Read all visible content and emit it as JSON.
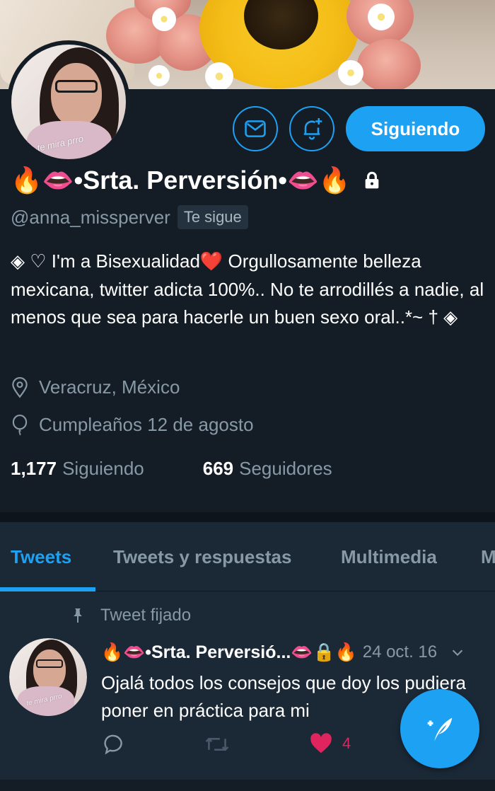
{
  "profile": {
    "display_name": "•Srta. Perversión•",
    "name_prefix_emoji": "🔥👄",
    "name_suffix_emoji": "👄🔥",
    "handle": "@anna_missperver",
    "follows_you": "Te sigue",
    "protected_icon": "lock-icon",
    "avatar_caption": "te mira prro",
    "bio": "◈ ♡ I'm a Bisexualidad❤️ Orgullosamente belleza mexicana, twitter adicta 100%.. No te arrodillés a nadie, al menos que sea para hacerle un buen sexo oral..*~ † ◈",
    "location": "Veracruz, México",
    "birthday": "Cumpleaños 12 de agosto",
    "following_count": "1,177",
    "following_label": "Siguiendo",
    "followers_count": "669",
    "followers_label": "Seguidores"
  },
  "actions": {
    "message_icon": "envelope-icon",
    "notify_icon": "bell-plus-icon",
    "follow_button_label": "Siguiendo"
  },
  "tabs": [
    {
      "label": "Tweets",
      "active": true
    },
    {
      "label": "Tweets y respuestas",
      "active": false
    },
    {
      "label": "Multimedia",
      "active": false
    },
    {
      "label": "M",
      "active": false
    }
  ],
  "pinned_tweet": {
    "pinned_label": "Tweet fijado",
    "author_name": "🔥👄•Srta. Perversió...👄🔒🔥",
    "date": "24 oct. 16",
    "text": "Ojalá todos los consejos que doy los pudiera poner en práctica para mi",
    "like_count": "4"
  },
  "colors": {
    "background": "#141d26",
    "card": "#1b2836",
    "accent": "#1da1f2",
    "muted": "#8899a6",
    "like": "#e0245e"
  }
}
